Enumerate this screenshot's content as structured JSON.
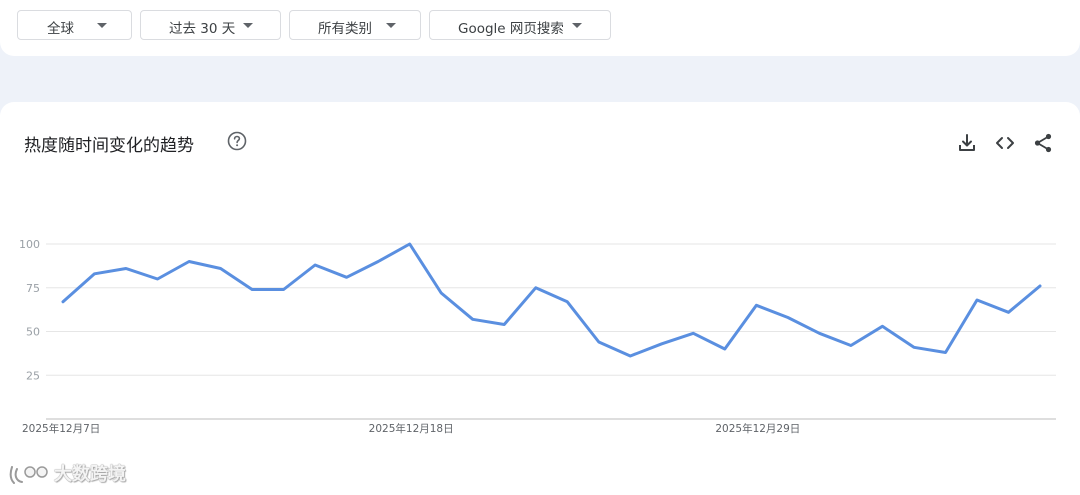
{
  "filters": {
    "region": "全球",
    "time_range": "过去 30 天",
    "category": "所有类别",
    "search_type": "Google 网页搜索"
  },
  "card": {
    "title": "热度随时间变化的趋势"
  },
  "watermark": "大数跨境",
  "chart_data": {
    "type": "line",
    "title": "热度随时间变化的趋势",
    "x_tick_labels": [
      "2025年12月7日",
      "2025年12月18日",
      "2025年12月29日"
    ],
    "x_start_date": "2025-12-07",
    "y_tick_labels": [
      "100",
      "75",
      "50",
      "25"
    ],
    "ylim": [
      0,
      100
    ],
    "grid": true,
    "line_color": "#5a8fe0",
    "series": [
      {
        "values": [
          67,
          83,
          86,
          80,
          90,
          86,
          74,
          74,
          88,
          81,
          90,
          100,
          72,
          57,
          54,
          75,
          67,
          44,
          36,
          43,
          49,
          40,
          65,
          58,
          49,
          42,
          53,
          41,
          38,
          68,
          61,
          76
        ]
      }
    ]
  }
}
